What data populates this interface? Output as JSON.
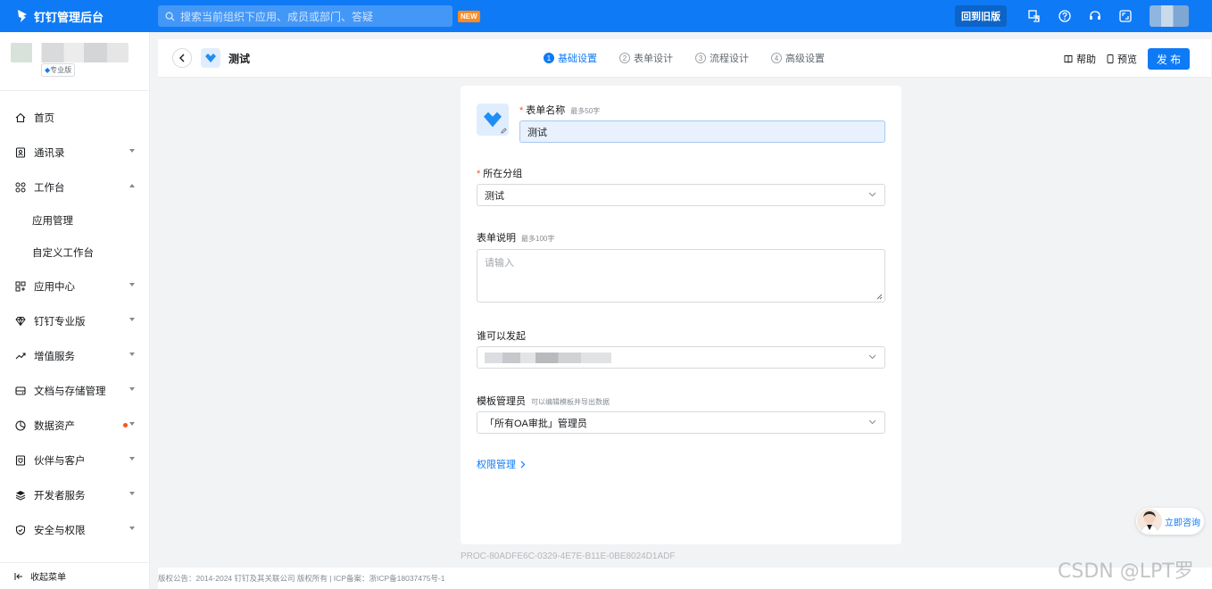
{
  "topbar": {
    "brand": "钉钉管理后台",
    "search_placeholder": "搜索当前组织下应用、成员或部门、答疑",
    "new_badge": "NEW",
    "old_version_button": "回到旧版"
  },
  "sidebar": {
    "pro_tag": "专业版",
    "items": [
      {
        "label": "首页",
        "icon": "home-icon"
      },
      {
        "label": "通讯录",
        "icon": "contacts-icon"
      },
      {
        "label": "工作台",
        "icon": "grid-icon"
      },
      {
        "label": "应用中心",
        "icon": "apps-icon"
      },
      {
        "label": "钉钉专业版",
        "icon": "diamond-icon"
      },
      {
        "label": "增值服务",
        "icon": "trend-icon"
      },
      {
        "label": "文档与存储管理",
        "icon": "storage-icon"
      },
      {
        "label": "数据资产",
        "icon": "data-icon"
      },
      {
        "label": "伙伴与客户",
        "icon": "partner-icon"
      },
      {
        "label": "开发者服务",
        "icon": "layers-icon"
      },
      {
        "label": "安全与权限",
        "icon": "shield-icon"
      }
    ],
    "sub_items": [
      "应用管理",
      "自定义工作台"
    ],
    "collapse": "收起菜单"
  },
  "header": {
    "title": "测试",
    "steps": [
      {
        "num": "1",
        "label": "基础设置"
      },
      {
        "num": "2",
        "label": "表单设计"
      },
      {
        "num": "3",
        "label": "流程设计"
      },
      {
        "num": "4",
        "label": "高级设置"
      }
    ],
    "help": "帮助",
    "preview": "预览",
    "publish": "发 布"
  },
  "form": {
    "name_label": "表单名称",
    "name_hint": "最多50字",
    "name_value": "测试",
    "group_label": "所在分组",
    "group_value": "测试",
    "desc_label": "表单说明",
    "desc_hint": "最多100字",
    "desc_placeholder": "请输入",
    "initiator_label": "谁可以发起",
    "admin_label": "模板管理员",
    "admin_hint": "可以编辑模板并导出数据",
    "admin_value": "「所有OA审批」管理员",
    "permission_link": "权限管理"
  },
  "proc_id": "PROC-80ADFE6C-0329-4E7E-B11E-0BE8024D1ADF",
  "footer": "版权公告：2014-2024 钉钉及其关联公司 版权所有 | ICP备案：浙ICP备18037475号-1",
  "consult": "立即咨询",
  "watermark": "CSDN @LPT罗",
  "colors": {
    "accent": "#0f7af5",
    "required": "#ff5219"
  }
}
